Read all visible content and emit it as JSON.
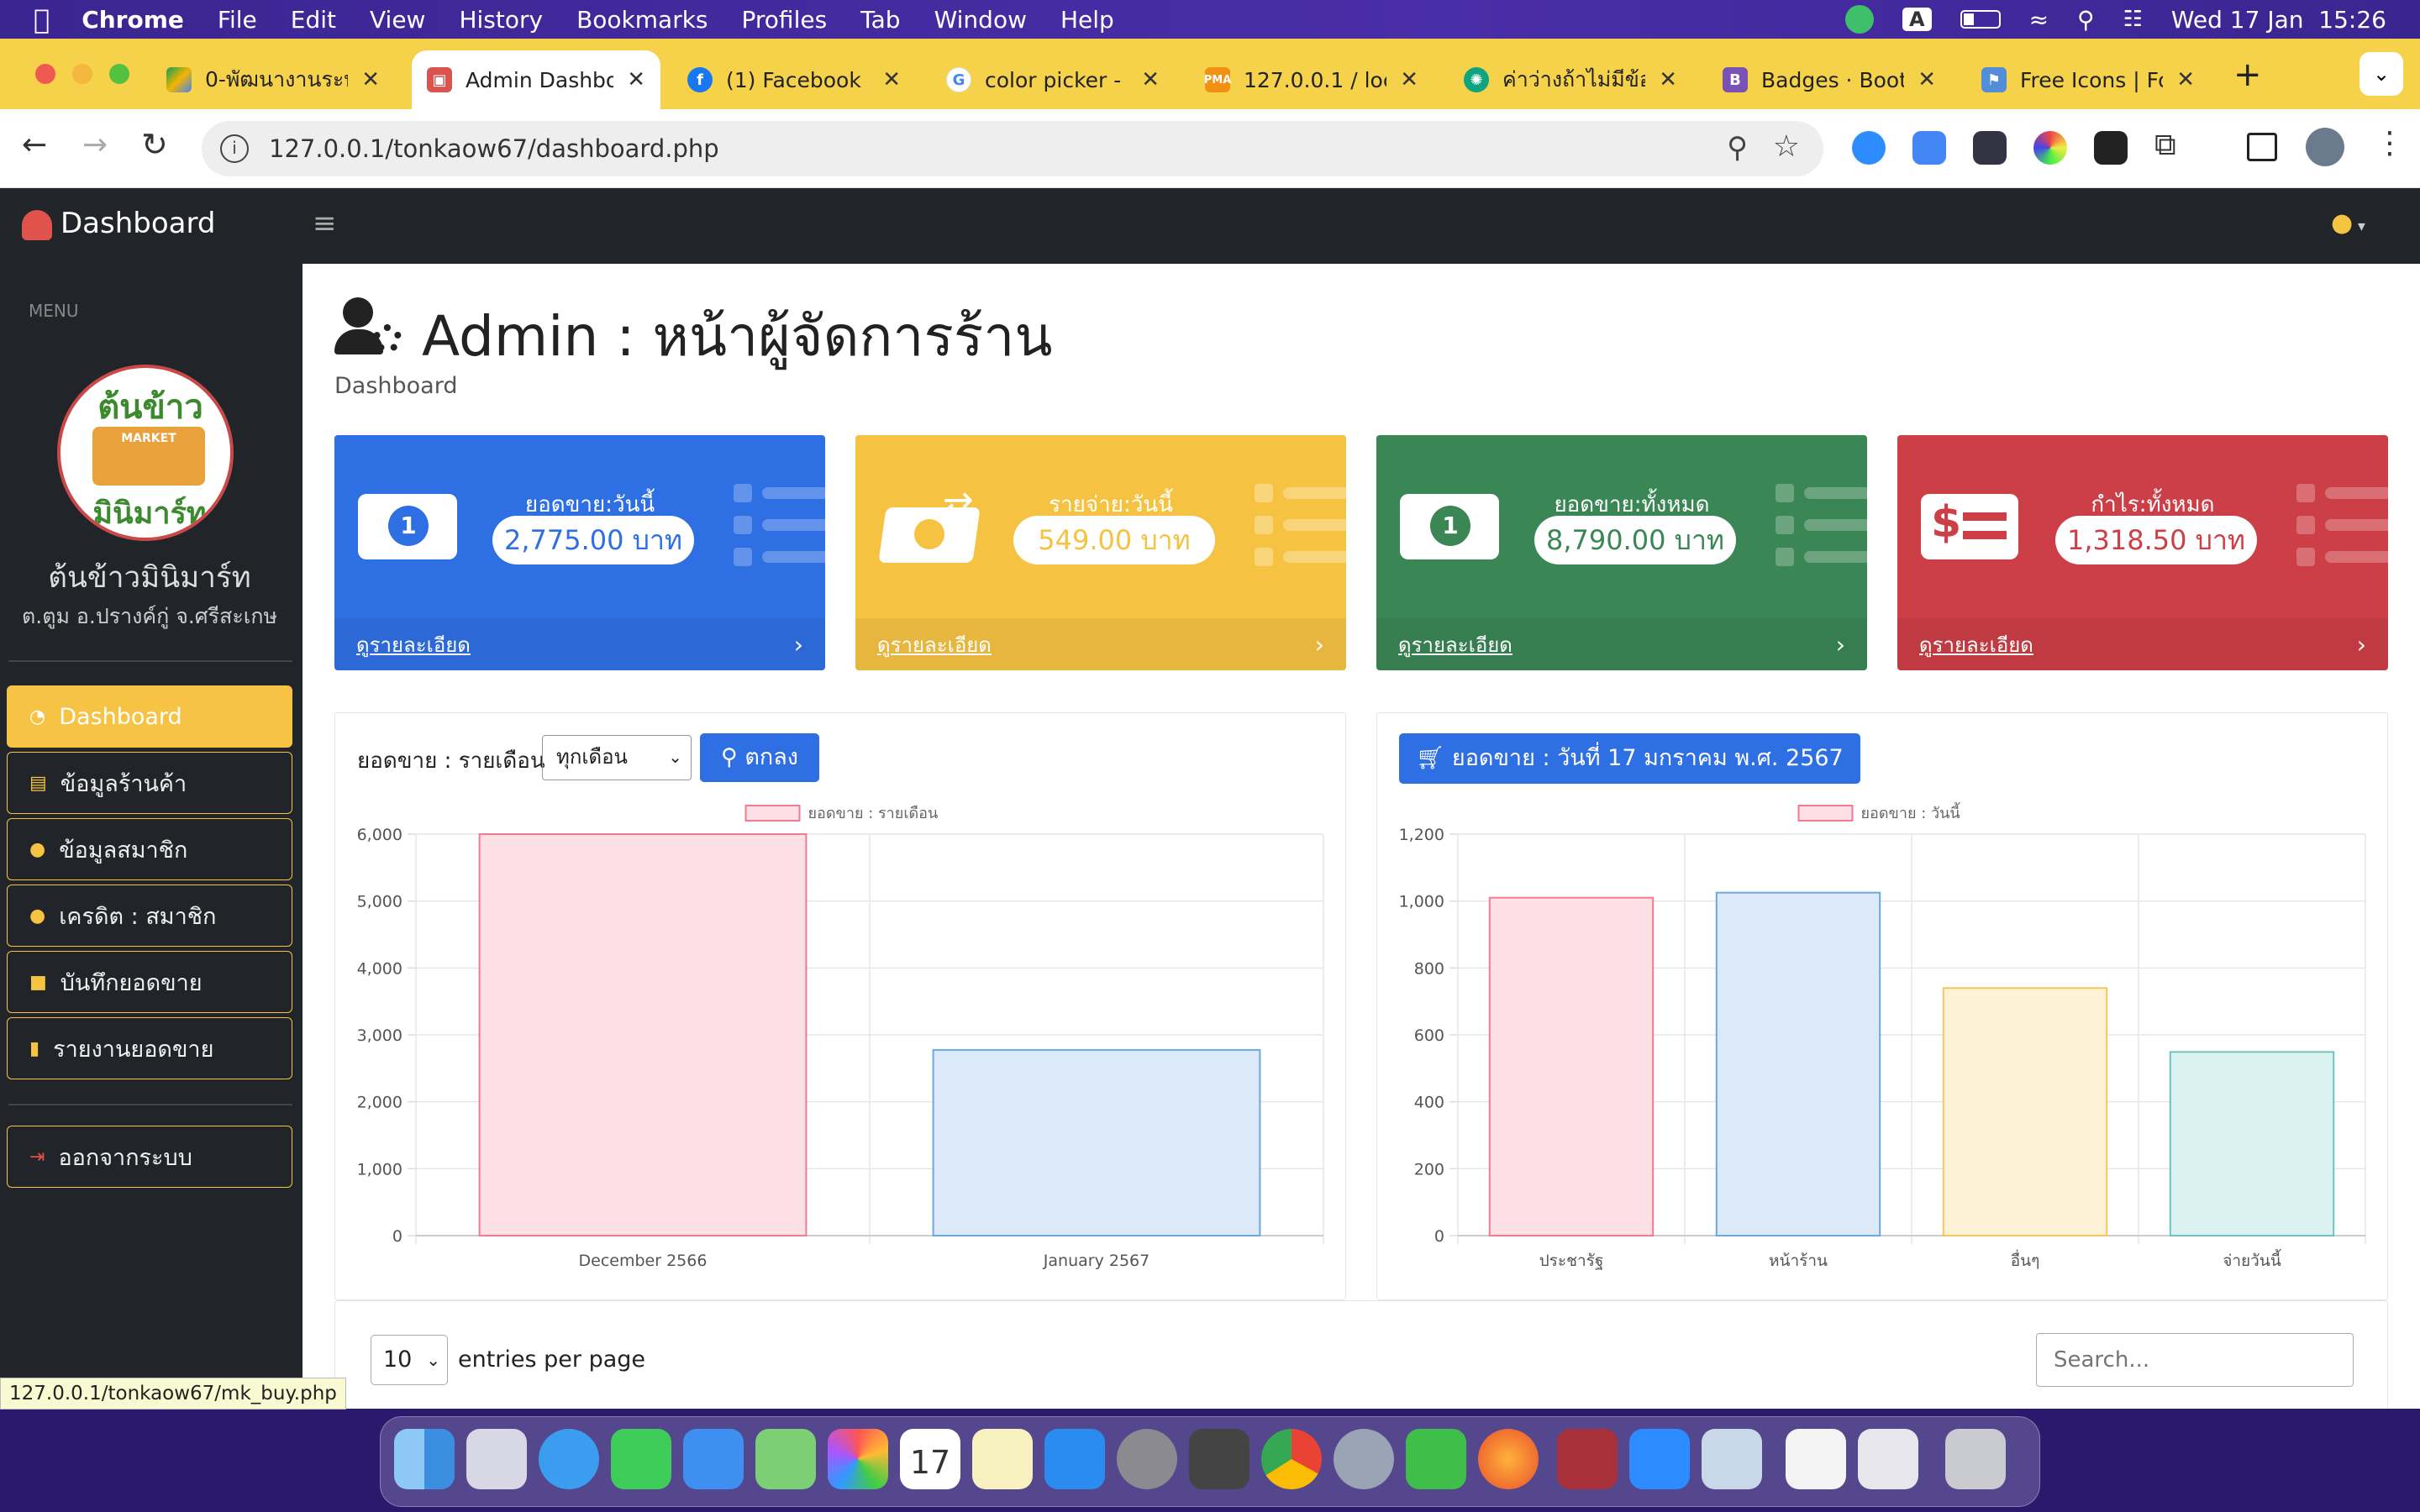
{
  "menubar": {
    "app": "Chrome",
    "items": [
      "File",
      "Edit",
      "View",
      "History",
      "Bookmarks",
      "Profiles",
      "Tab",
      "Window",
      "Help"
    ],
    "datetime": "Wed 17 Jan  15:26",
    "input_badge": "A"
  },
  "tabs": [
    {
      "title": "0-พัฒนางานระบ",
      "icon": "google-drive-icon",
      "color": "#1a73e8"
    },
    {
      "title": "Admin Dashbo",
      "icon": "dashboard-favicon",
      "color": "#d9534f"
    },
    {
      "title": "(1) Facebook",
      "icon": "facebook-icon",
      "color": "#1877f2"
    },
    {
      "title": "color picker - G",
      "icon": "google-icon",
      "color": "#4285f4"
    },
    {
      "title": "127.0.0.1 / loca",
      "icon": "phpmyadmin-icon",
      "color": "#f29111"
    },
    {
      "title": "ค่าว่างถ้าไม่มีข้อ",
      "icon": "chatgpt-icon",
      "color": "#10a37f"
    },
    {
      "title": "Badges · Boots",
      "icon": "bootstrap-icon",
      "color": "#7952b3"
    },
    {
      "title": "Free Icons | Fo",
      "icon": "fontawesome-icon",
      "color": "#538dd7"
    }
  ],
  "url": "127.0.0.1/tonkaow67/dashboard.php",
  "brand": "Dashboard",
  "sidebar": {
    "heading": "MENU",
    "logo_text_top": "ต้นข้าว",
    "logo_text_bottom": "มินิมาร์ท",
    "logo_small": "MARKET",
    "shop_name": "ต้นข้าวมินิมาร์ท",
    "address": "ต.ตูม อ.ปรางค์กู่ จ.ศรีสะเกษ",
    "items": [
      {
        "label": "Dashboard",
        "icon": "gauge-icon"
      },
      {
        "label": "ข้อมูลร้านค้า",
        "icon": "store-icon"
      },
      {
        "label": "ข้อมูลสมาชิก",
        "icon": "user-icon"
      },
      {
        "label": "เครดิต : สมาชิก",
        "icon": "user-icon"
      },
      {
        "label": "บันทึกยอดขาย",
        "icon": "save-icon"
      },
      {
        "label": "รายงานยอดขาย",
        "icon": "file-invoice-icon"
      }
    ],
    "logout": "ออกจากระบบ"
  },
  "page": {
    "title": "Admin : หน้าผู้จัดการร้าน",
    "subtitle": "Dashboard"
  },
  "cards": [
    {
      "label": "ยอดขาย:วันนี้",
      "value": "2,775.00 บาท",
      "link": "ดูรายละเอียด",
      "color": "#2f6fe4"
    },
    {
      "label": "รายจ่าย:วันนี้",
      "value": "549.00 บาท",
      "link": "ดูรายละเอียด",
      "color": "#f5c242"
    },
    {
      "label": "ยอดขาย:ทั้งหมด",
      "value": "8,790.00 บาท",
      "link": "ดูรายละเอียด",
      "color": "#3a8655"
    },
    {
      "label": "กำไร:ทั้งหมด",
      "value": "1,318.50 บาท",
      "link": "ดูรายละเอียด",
      "color": "#cc3f46"
    }
  ],
  "monthly": {
    "filter_label": "ยอดขาย : รายเดือน",
    "select_value": "ทุกเดือน",
    "button": "ตกลง"
  },
  "daily": {
    "header": "ยอดขาย : วันที่ 17 มกราคม พ.ศ. 2567"
  },
  "table": {
    "page_size": "10",
    "entries_label": "entries per page",
    "search_placeholder": "Search..."
  },
  "status_url": "127.0.0.1/tonkaow67/mk_buy.php",
  "chart_data": [
    {
      "type": "bar",
      "legend": "ยอดขาย : รายเดือน",
      "categories": [
        "December 2566",
        "January 2567"
      ],
      "values": [
        6000,
        2775
      ],
      "ylim": [
        0,
        6000
      ],
      "yticks": [
        0,
        1000,
        2000,
        3000,
        4000,
        5000,
        6000
      ],
      "fills": [
        "#fde0e6",
        "#dce9f8"
      ],
      "strokes": [
        "#f27a93",
        "#6aa9e0"
      ]
    },
    {
      "type": "bar",
      "legend": "ยอดขาย : วันนี้",
      "categories": [
        "ประชารัฐ",
        "หน้าร้าน",
        "อื่นๆ",
        "จ่ายวันนี้"
      ],
      "values": [
        1010,
        1025,
        740,
        549
      ],
      "ylim": [
        0,
        1200
      ],
      "yticks": [
        0,
        200,
        400,
        600,
        800,
        1000,
        1200
      ],
      "fills": [
        "#fde0e6",
        "#dce9f8",
        "#fdf1d6",
        "#dcf2f0"
      ],
      "strokes": [
        "#f27a93",
        "#6aa9e0",
        "#f5c75f",
        "#6cc3c0"
      ]
    }
  ]
}
